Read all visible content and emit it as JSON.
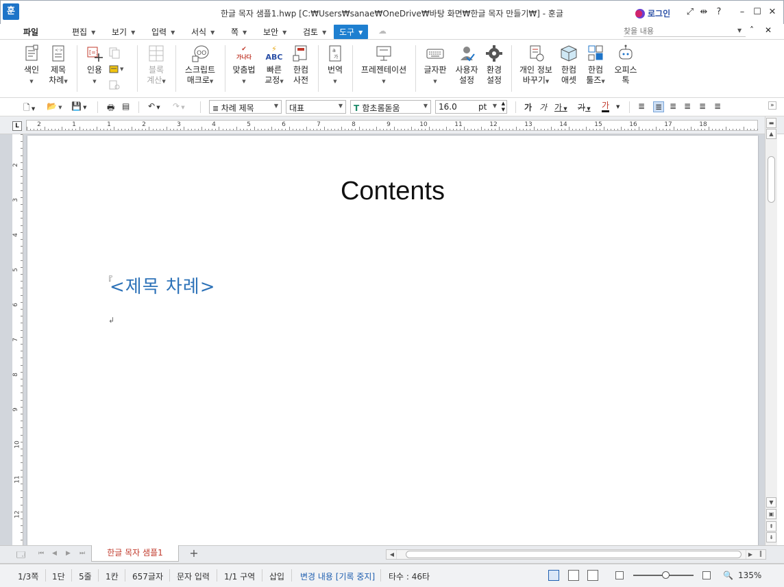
{
  "window": {
    "title": "한글 목자 샘플1.hwp [C:₩Users₩sanae₩OneDrive₩바탕 화면₩한글 목자 만들기₩] - 훈글",
    "app_icon": "훈",
    "login_label": "로그인"
  },
  "menu": {
    "items": [
      "파일",
      "편집",
      "보기",
      "입력",
      "서식",
      "쪽",
      "보안",
      "검토",
      "도구"
    ],
    "active": "도구",
    "search_placeholder": "찾을 내용"
  },
  "ribbon": {
    "groups": [
      {
        "label1": "색인",
        "label2": "",
        "icon": "index-icon"
      },
      {
        "label1": "제목",
        "label2": "차례",
        "icon": "toc-icon"
      },
      {
        "label1": "인용",
        "label2": "",
        "icon": "citation-icon"
      },
      {
        "label1": "블록",
        "label2": "계산",
        "icon": "block-calc-icon"
      },
      {
        "label1": "스크립트",
        "label2": "매크로",
        "icon": "script-macro-icon"
      },
      {
        "label1": "맞춤법",
        "label2": "",
        "icon": "spellcheck-icon"
      },
      {
        "label1": "빠른",
        "label2": "교정",
        "icon": "quick-correct-icon"
      },
      {
        "label1": "한컴",
        "label2": "사전",
        "icon": "dictionary-icon"
      },
      {
        "label1": "번역",
        "label2": "",
        "icon": "translate-icon"
      },
      {
        "label1": "프레젠테이션",
        "label2": "",
        "icon": "presentation-icon"
      },
      {
        "label1": "글자판",
        "label2": "",
        "icon": "keyboard-icon"
      },
      {
        "label1": "사용자",
        "label2": "설정",
        "icon": "user-settings-icon"
      },
      {
        "label1": "환경",
        "label2": "설정",
        "icon": "gear-icon"
      },
      {
        "label1": "개인 정보",
        "label2": "바꾸기",
        "icon": "personal-info-icon"
      },
      {
        "label1": "한컴",
        "label2": "애셋",
        "icon": "asset-icon"
      },
      {
        "label1": "한컴",
        "label2": "툴즈",
        "icon": "tools-icon"
      },
      {
        "label1": "오피스",
        "label2": "톡",
        "icon": "office-talk-icon"
      }
    ],
    "spell_icon_text": "가나다",
    "quick_icon_text": "ABC"
  },
  "format": {
    "style": "차례 제목",
    "lang": "대표",
    "font": "함초롬돋움",
    "size": "16.0",
    "unit": "pt",
    "bold": "가",
    "italic": "가",
    "underline": "가",
    "strike": "가",
    "color_char": "가"
  },
  "ruler": {
    "h_numbers": [
      "2",
      "1",
      "1",
      "2",
      "3",
      "4",
      "5",
      "6",
      "7",
      "8",
      "9",
      "10",
      "11",
      "12",
      "13",
      "14",
      "15",
      "16",
      "17",
      "18"
    ],
    "v_numbers": [
      "2",
      "3",
      "4",
      "5",
      "6",
      "7",
      "8",
      "9",
      "10",
      "11",
      "12"
    ],
    "corner": "L"
  },
  "document": {
    "heading": "Contents",
    "toc_field": "<제목 차례>",
    "field_mark": "『",
    "para_mark": "↲"
  },
  "tabs": {
    "doc_tab": "한글 목자 샘플1",
    "add": "+"
  },
  "status": {
    "page": "1/3쪽",
    "column": "1단",
    "line": "5줄",
    "char_col": "1칸",
    "chars": "657글자",
    "mode": "문자 입력",
    "section": "1/1 구역",
    "insert": "삽입",
    "track": "변경 내용 [기록 중지]",
    "typing": "타수 : 46타",
    "zoom": "135%"
  }
}
